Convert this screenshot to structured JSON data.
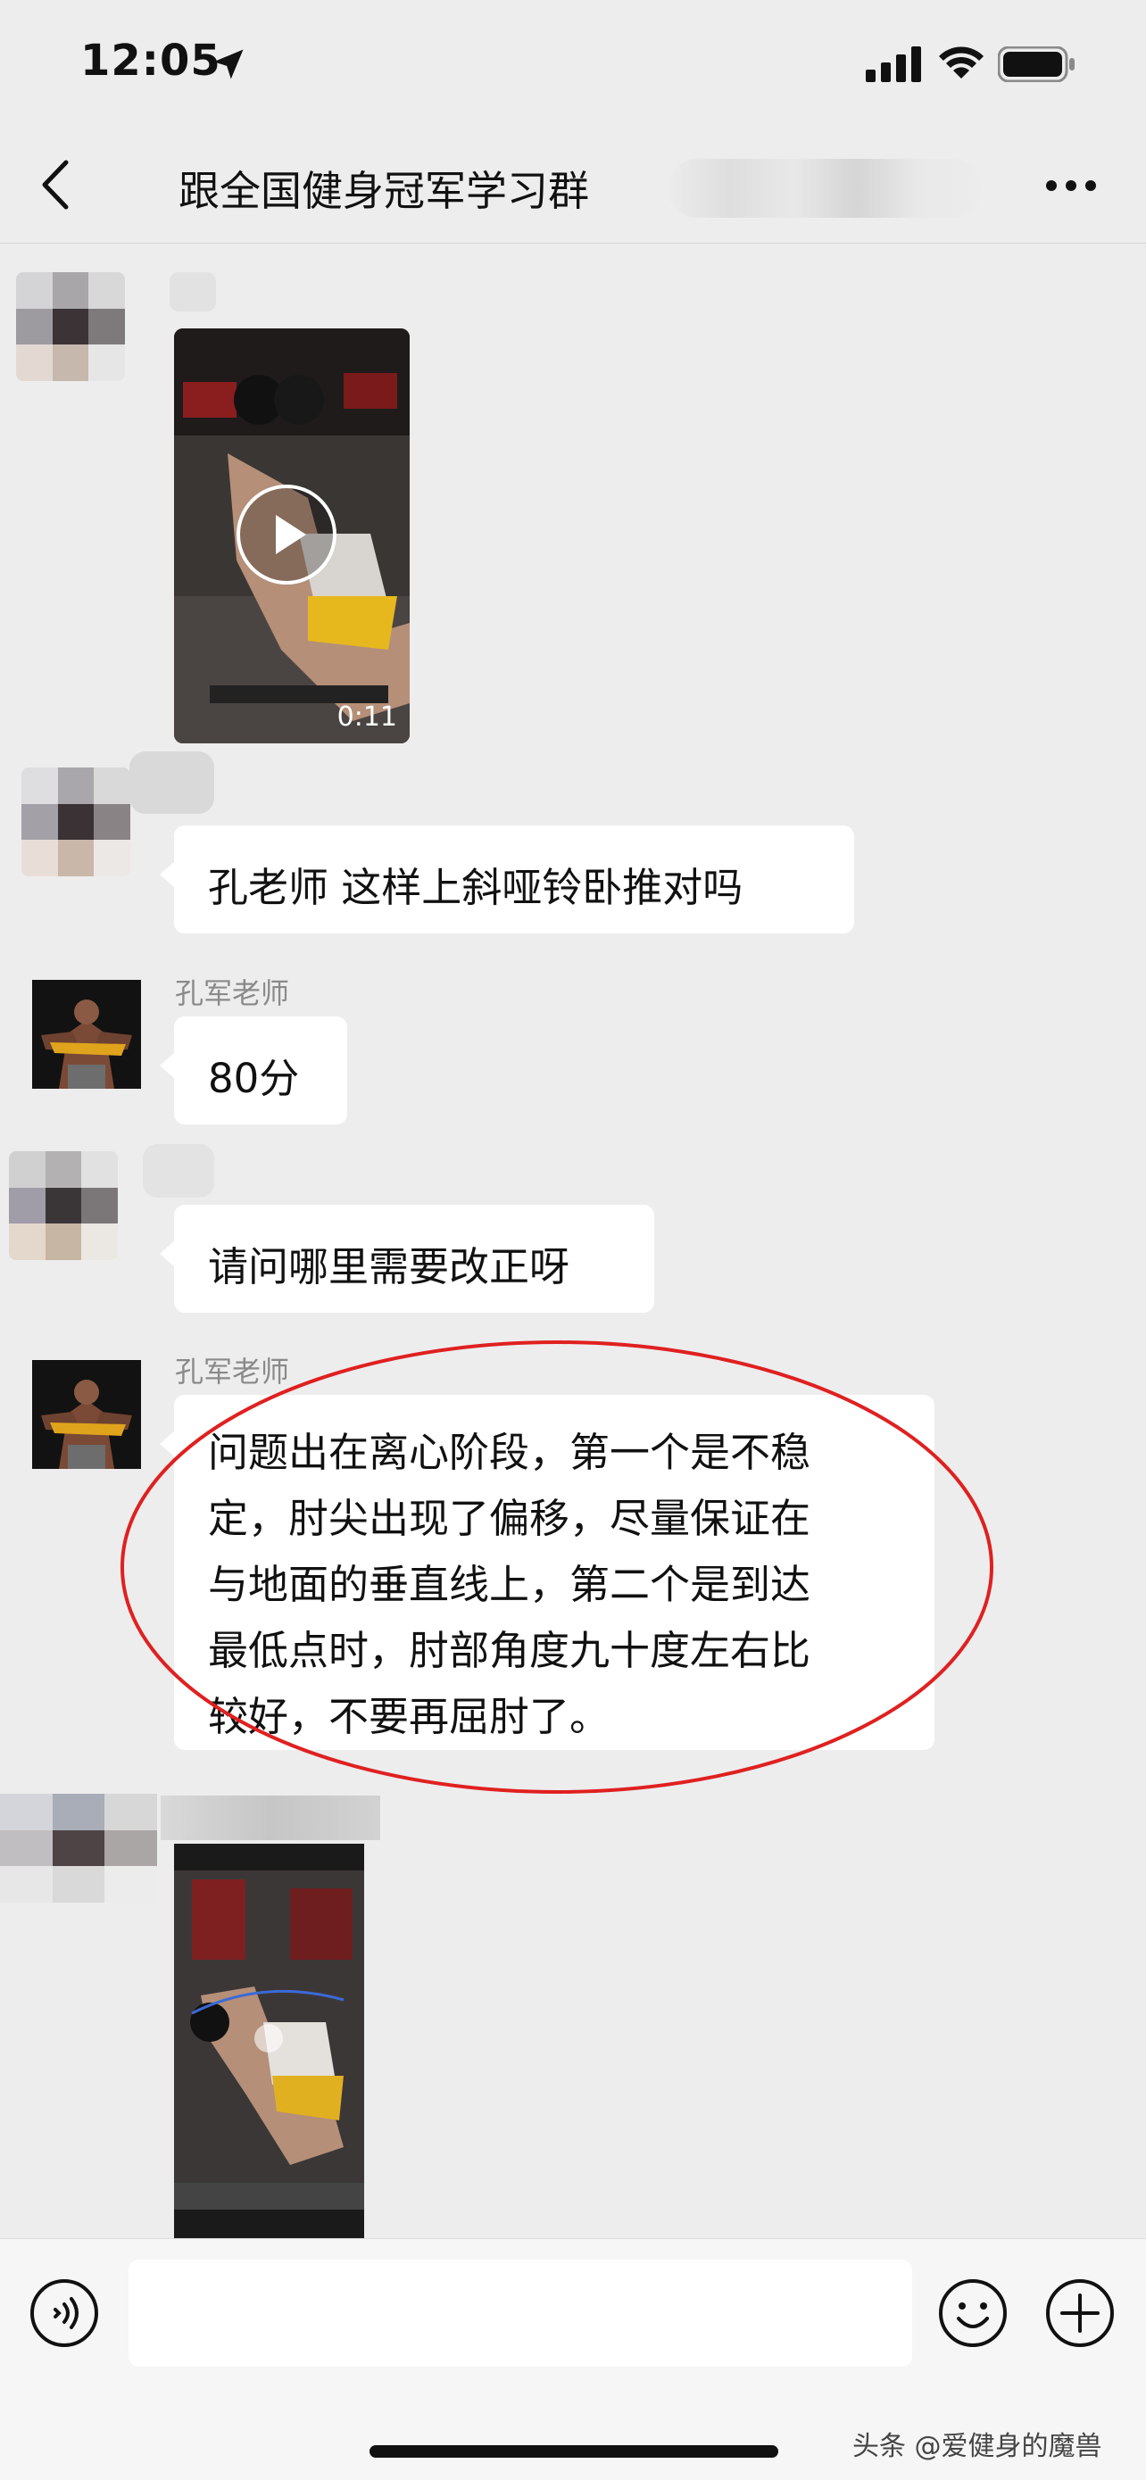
{
  "status_bar": {
    "time": "12:05"
  },
  "header": {
    "title": "跟全国健身冠军学习群"
  },
  "messages": [
    {
      "type": "video",
      "duration": "0:11"
    },
    {
      "type": "text",
      "text": "孔老师 这样上斜哑铃卧推对吗"
    },
    {
      "type": "text",
      "sender": "孔军老师",
      "text": "80分"
    },
    {
      "type": "text",
      "text": "请问哪里需要改正呀"
    },
    {
      "type": "text",
      "sender": "孔军老师",
      "lines": [
        "问题出在离心阶段，第一个是不稳",
        "定，肘尖出现了偏移，尽量保证在",
        "与地面的垂直线上，第二个是到达",
        "最低点时，肘部角度九十度左右比",
        "较好，不要再屈肘了。"
      ]
    },
    {
      "type": "video"
    }
  ],
  "input_bar": {
    "placeholder": ""
  },
  "watermark": "头条 @爱健身的魔兽",
  "colors": {
    "background": "#ededed",
    "bubble": "#ffffff",
    "annotation": "#e02020"
  }
}
